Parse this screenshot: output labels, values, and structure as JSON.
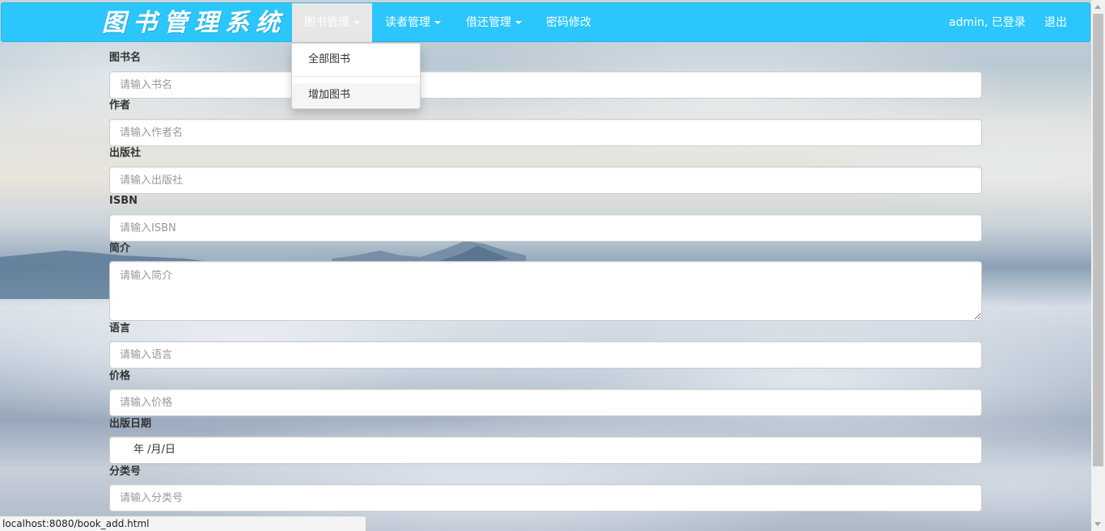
{
  "navbar": {
    "brand": "图书管理系统",
    "items": [
      {
        "label": "图书管理",
        "has_caret": true,
        "active": true
      },
      {
        "label": "读者管理",
        "has_caret": true,
        "active": false
      },
      {
        "label": "借还管理",
        "has_caret": true,
        "active": false
      },
      {
        "label": "密码修改",
        "has_caret": false,
        "active": false
      }
    ],
    "user_status": "admin, 已登录",
    "logout": "退出",
    "color": "#2bc6fc"
  },
  "dropdown": {
    "items": [
      "全部图书",
      "增加图书"
    ],
    "hovered": "增加图书"
  },
  "form": {
    "fields": [
      {
        "label": "图书名",
        "placeholder": "请输入书名"
      },
      {
        "label": "作者",
        "placeholder": "请输入作者名"
      },
      {
        "label": "出版社",
        "placeholder": "请输入出版社"
      },
      {
        "label": "ISBN",
        "placeholder": "请输入ISBN"
      },
      {
        "label": "简介",
        "placeholder": "请输入简介"
      },
      {
        "label": "语言",
        "placeholder": "请输入语言"
      },
      {
        "label": "价格",
        "placeholder": "请输入价格"
      },
      {
        "label": "出版日期",
        "value": "年 /月/日"
      },
      {
        "label": "分类号",
        "placeholder": "请输入分类号"
      }
    ]
  },
  "status_bar": {
    "url": "localhost:8080/book_add.html"
  }
}
